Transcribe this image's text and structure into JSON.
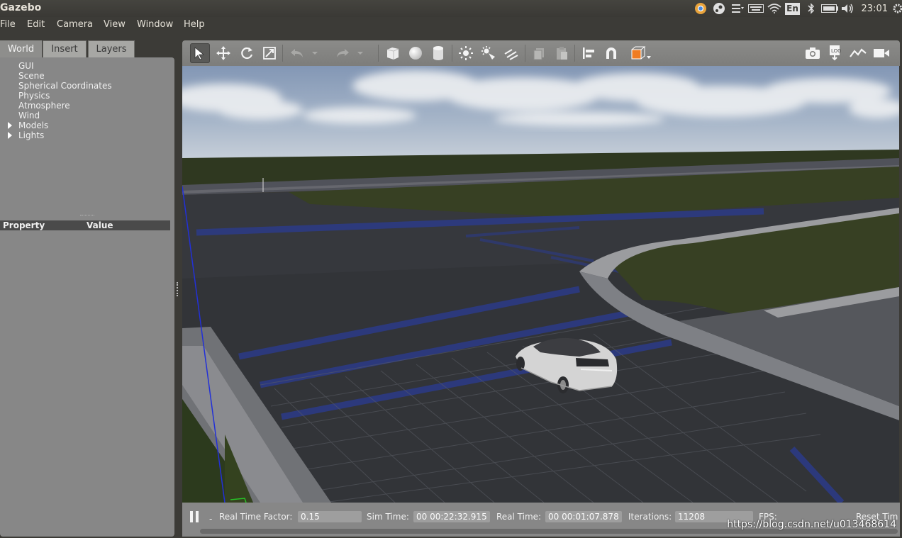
{
  "window": {
    "title": "Gazebo"
  },
  "system_tray": {
    "icons": [
      "chrome-icon",
      "steam-icon",
      "input-method-icon",
      "keyboard-icon",
      "wifi-icon",
      "keyboard-language-icon",
      "bluetooth-icon",
      "battery-icon",
      "volume-icon",
      "settings-icon"
    ],
    "language": "En",
    "clock": "23:01"
  },
  "menubar": {
    "items": [
      "File",
      "Edit",
      "Camera",
      "View",
      "Window",
      "Help"
    ]
  },
  "left_panel": {
    "tabs": [
      "World",
      "Insert",
      "Layers"
    ],
    "active_tab": "World",
    "tree": [
      "GUI",
      "Scene",
      "Spherical Coordinates",
      "Physics",
      "Atmosphere",
      "Wind",
      "Models",
      "Lights"
    ],
    "expandable": [
      "Models",
      "Lights"
    ],
    "property_headers": {
      "property": "Property",
      "value": "Value"
    }
  },
  "toolbar": {
    "tools": [
      "select-mode",
      "translate-mode",
      "rotate-mode",
      "scale-mode",
      "undo",
      "undo-history",
      "redo",
      "redo-history",
      "box-shape",
      "sphere-shape",
      "cylinder-shape",
      "point-light",
      "spot-light",
      "directional-light",
      "copy",
      "paste",
      "align",
      "snap",
      "change-view",
      "screenshot",
      "log",
      "plot",
      "record-video"
    ],
    "selected": "select-mode",
    "accent_color": "#f07c22"
  },
  "status_bar": {
    "real_time_factor_label": "Real Time Factor:",
    "real_time_factor": "0.15",
    "sim_time_label": "Sim Time:",
    "sim_time": "00 00:22:32.915",
    "real_time_label": "Real Time:",
    "real_time": "00 00:01:07.878",
    "iterations_label": "Iterations:",
    "iterations": "11208",
    "fps_label": "FPS:",
    "reset_time_label": "Reset Tim",
    "step_label": "-"
  },
  "watermark": "https://blog.csdn.net/u013468614",
  "colors": {
    "panel_bg": "#878787",
    "dark_bg": "#3c3b37",
    "grass": "#374023",
    "road": "#35373c",
    "lane_blue": "#2b3a8a",
    "sky": "#8fa4bd"
  }
}
